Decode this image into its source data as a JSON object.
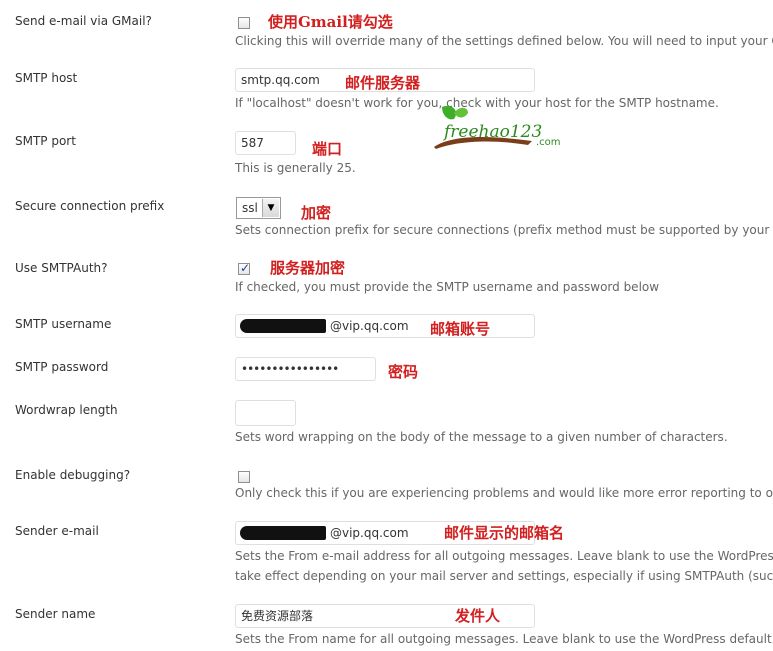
{
  "settings": {
    "gmail": {
      "label": "Send e-mail via GMail?",
      "annotation": "使用Gmail请勾选",
      "description": "Clicking this will override many of the settings defined below. You will need to input your GMail",
      "checked": false
    },
    "host": {
      "label": "SMTP host",
      "value": "smtp.qq.com",
      "annotation": "邮件服务器",
      "description": "If \"localhost\" doesn't work for you, check with your host for the SMTP hostname."
    },
    "port": {
      "label": "SMTP port",
      "value": "587",
      "annotation": "端口",
      "description": "This is generally 25."
    },
    "prefix": {
      "label": "Secure connection prefix",
      "value": "ssl",
      "annotation": "加密",
      "description": "Sets connection prefix for secure connections (prefix method must be supported by your PHP"
    },
    "auth": {
      "label": "Use SMTPAuth?",
      "annotation": "服务器加密",
      "description": "If checked, you must provide the SMTP username and password below",
      "checked": true
    },
    "username": {
      "label": "SMTP username",
      "value": "@vip.qq.com",
      "annotation": "邮箱账号"
    },
    "password": {
      "label": "SMTP password",
      "value": "••••••••••••••••",
      "annotation": "密码"
    },
    "wordwrap": {
      "label": "Wordwrap length",
      "value": "",
      "description": "Sets word wrapping on the body of the message to a given number of characters."
    },
    "debug": {
      "label": "Enable debugging?",
      "description": "Only check this if you are experiencing problems and would like more error reporting to occu",
      "checked": false
    },
    "sender_email": {
      "label": "Sender e-mail",
      "value": "@vip.qq.com",
      "annotation": "邮件显示的邮箱名",
      "description_line1": "Sets the From e-mail address for all outgoing messages. Leave blank to use the WordPress d",
      "description_line2": "take effect depending on your mail server and settings, especially if using SMTPAuth (such as"
    },
    "sender_name": {
      "label": "Sender name",
      "value": "免费资源部落",
      "annotation": "发件人",
      "description": "Sets the From name for all outgoing messages. Leave blank to use the WordPress default. Th"
    }
  },
  "watermark": {
    "text": "freehao123",
    "suffix": ".com"
  },
  "icons": {
    "select_arrow": "chevron-down-icon",
    "check": "checkmark-icon"
  },
  "colors": {
    "annotation": "#d21f1f",
    "label": "#333333",
    "description": "#666666",
    "watermark_green": "#2d8a1e"
  }
}
